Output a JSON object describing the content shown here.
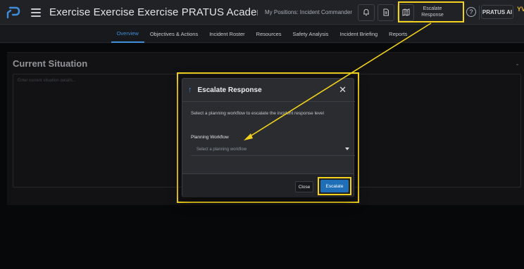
{
  "app": {
    "title": "Exercise Exercise Exercise PRATUS Academy Power...",
    "positions": "My Positions: Incident Commander",
    "escalate_button": "Escalate Response",
    "help": "?",
    "ai_button": "PRATUS AI",
    "avatar": "YV"
  },
  "tabs": [
    {
      "label": "Overview",
      "active": true
    },
    {
      "label": "Objectives & Actions"
    },
    {
      "label": "Incident Roster"
    },
    {
      "label": "Resources"
    },
    {
      "label": "Safety Analysis"
    },
    {
      "label": "Incident Briefing"
    },
    {
      "label": "Reports"
    }
  ],
  "section": {
    "title": "Current Situation",
    "placeholder": "Enter current situation details..."
  },
  "modal": {
    "title": "Escalate Response",
    "description": "Select a planning workflow to escalate the incident response level",
    "field_label": "Planning Workflow",
    "select_placeholder": "Select a planning workflow",
    "close_button": "Close",
    "escalate_button": "Escalate"
  },
  "colors": {
    "highlight": "#f2d21a",
    "accent": "#3f8ddb",
    "primary_button": "#1f6fb8"
  },
  "icons": [
    "logo-icon",
    "menu-icon",
    "bell-icon",
    "document-icon",
    "map-icon",
    "up-arrow-icon",
    "help-icon",
    "chevron-down-icon",
    "close-icon",
    "caret-down-icon"
  ]
}
